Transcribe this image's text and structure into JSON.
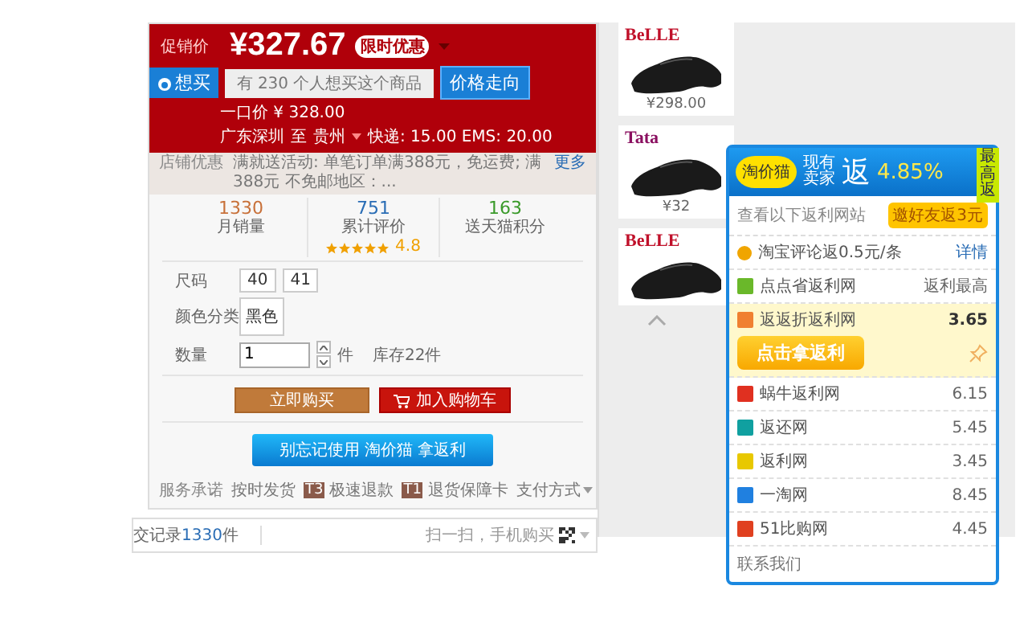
{
  "product": {
    "price_label": "促销价",
    "price": "¥327.67",
    "promo_badge": "限时优惠",
    "want_button": "想买",
    "want_text": "有 230 个人想买这个商品",
    "trend_button": "价格走向",
    "original_price": "一口价 ¥ 328.00",
    "shipping": {
      "from": "广东深圳",
      "to_word": "至",
      "to": "贵州",
      "fees": "快递: 15.00 EMS: 20.00"
    },
    "shop_promo": {
      "label": "店铺优惠",
      "text": "满就送活动: 单笔订单满388元，免运费; 满388元 不免邮地区：...",
      "more": "更多"
    },
    "stats": [
      {
        "value": "1330",
        "label": "月销量",
        "color": "#c8713a"
      },
      {
        "value": "751",
        "label": "累计评价",
        "color": "#2a6db5",
        "stars": 5,
        "rating": "4.8"
      },
      {
        "value": "163",
        "label": "送天猫积分",
        "color": "#3a9a2a"
      }
    ],
    "options": {
      "size_label": "尺码",
      "sizes": [
        {
          "label": "40",
          "selected": false
        },
        {
          "label": "41",
          "selected": false
        }
      ],
      "color_label": "颜色分类",
      "colors": [
        {
          "label": "黑色",
          "selected": false
        }
      ],
      "qty_label": "数量",
      "qty": "1",
      "unit": "件",
      "stock": "库存22件"
    },
    "buy_button": "立即购买",
    "cart_button": "加入购物车",
    "rebate_button": "别忘记使用 淘价猫 拿返利",
    "services": {
      "label": "服务承诺",
      "items": [
        {
          "text": "按时发货"
        },
        {
          "badge": "T3",
          "text": "极速退款"
        },
        {
          "badge": "T1",
          "text": "退货保障卡"
        }
      ],
      "payment": "支付方式"
    }
  },
  "bottom": {
    "records_prefix": "交记录",
    "records_count": "1330",
    "records_suffix": "件",
    "scan": "扫一扫，手机购买"
  },
  "shoes": [
    {
      "brand": "BeLLE",
      "color": "#c0102a",
      "price": "¥298.00"
    },
    {
      "brand": "Tata",
      "color": "#8a1060",
      "price": "¥32"
    },
    {
      "brand": "BeLLE",
      "color": "#c0102a"
    }
  ],
  "rebate_popup": {
    "logo": "淘价猫",
    "headline_top": "现有",
    "headline_bottom": "卖家",
    "headline_big": "返",
    "rate": "4.85%",
    "ribbon": "最高返",
    "intro": "查看以下返利网站",
    "invite_button": "邀好友返3元",
    "sites": [
      {
        "kind": "comment",
        "name": "淘宝评论返0.5元/条",
        "value": "详情",
        "color": "#f0a500",
        "selected": false
      },
      {
        "kind": "site",
        "name": "点点省返利网",
        "value": "返利最高",
        "color": "#6ab82a",
        "selected": false
      },
      {
        "kind": "site",
        "name": "返返折返利网",
        "value": "3.65",
        "color": "#f08030",
        "selected": true
      },
      {
        "kind": "site",
        "name": "蜗牛返利网",
        "value": "6.15",
        "color": "#e03020",
        "selected": false
      },
      {
        "kind": "site",
        "name": "返还网",
        "value": "5.45",
        "color": "#10a0a0",
        "selected": false
      },
      {
        "kind": "site",
        "name": "返利网",
        "value": "3.45",
        "color": "#e8c800",
        "selected": false
      },
      {
        "kind": "site",
        "name": "一淘网",
        "value": "8.45",
        "color": "#2080e0",
        "selected": false
      },
      {
        "kind": "site",
        "name": "51比购网",
        "value": "4.45",
        "color": "#e04020",
        "selected": false
      }
    ],
    "claim_button": "点击拿返利",
    "contact": "联系我们"
  }
}
